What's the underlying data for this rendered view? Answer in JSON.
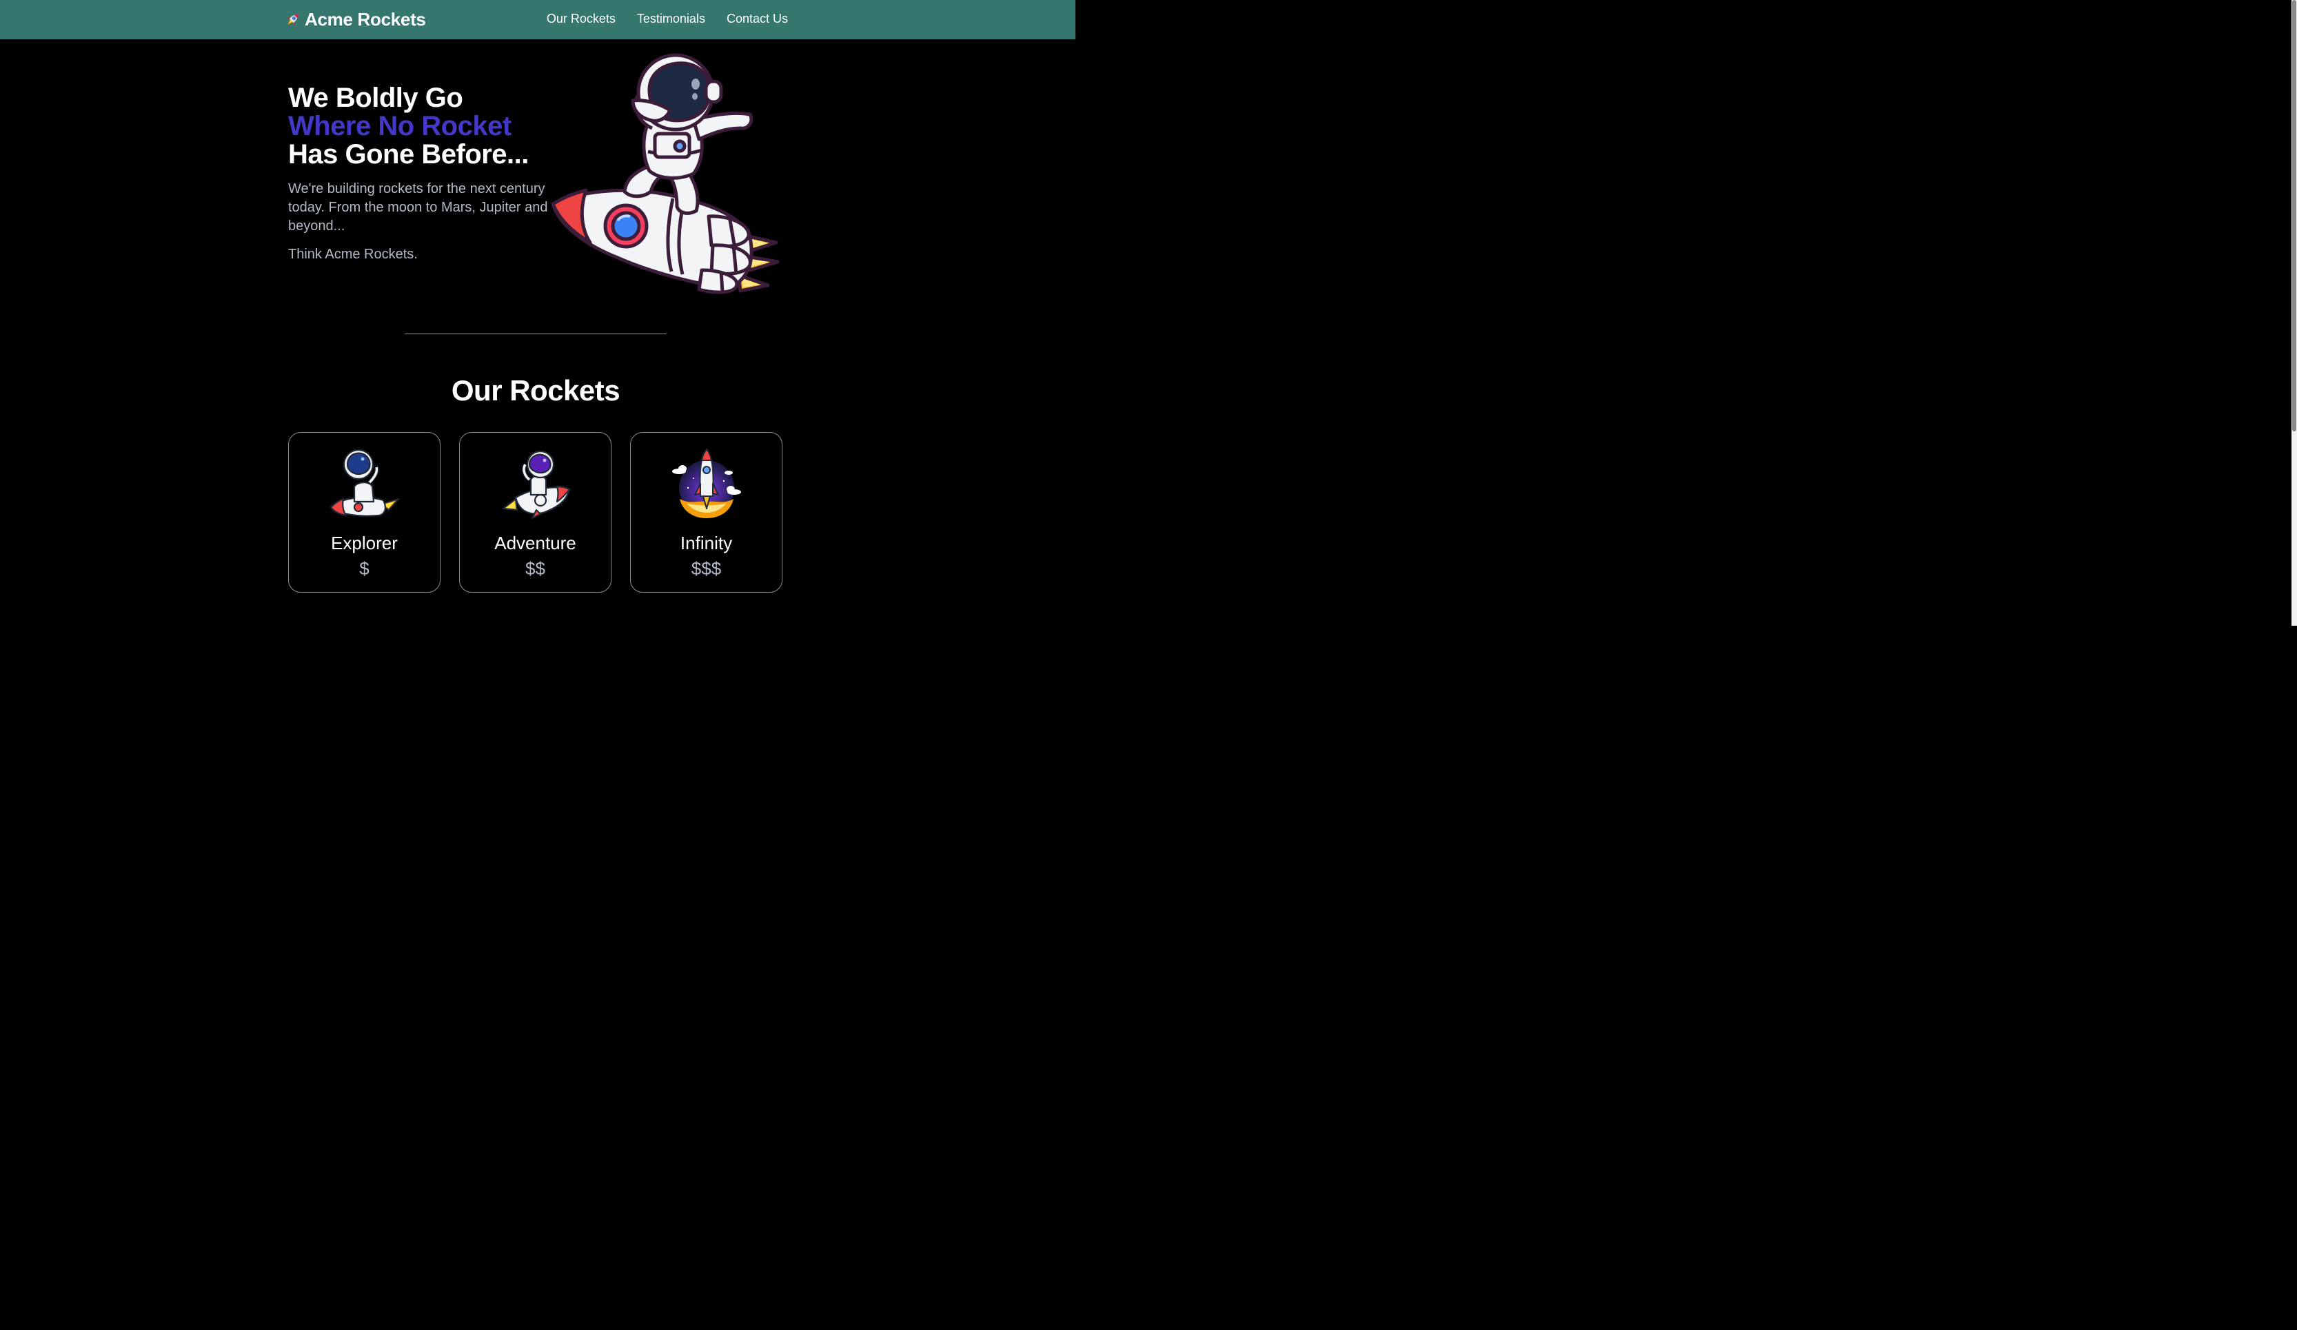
{
  "nav": {
    "brand": "Acme Rockets",
    "brand_icon": "rocket-emoji-icon",
    "links": [
      "Our Rockets",
      "Testimonials",
      "Contact Us"
    ],
    "background": "#35766f"
  },
  "hero": {
    "title_line1": "We Boldly Go",
    "title_line2": "Where No Rocket",
    "title_line3": "Has Gone Before...",
    "accent_color": "#4338ca",
    "subtitle": "We're building rockets for the next century today. From the moon to Mars, Jupiter and beyond...",
    "tagline": "Think Acme Rockets.",
    "illustration": "astronaut-riding-rocket-icon"
  },
  "rockets": {
    "title": "Our Rockets",
    "cards": [
      {
        "name": "Explorer",
        "price": "$",
        "icon": "astronaut-on-red-rocket-icon"
      },
      {
        "name": "Adventure",
        "price": "$$",
        "icon": "astronaut-waving-on-rocket-icon"
      },
      {
        "name": "Infinity",
        "price": "$$$",
        "icon": "rocket-launch-icon"
      }
    ]
  }
}
